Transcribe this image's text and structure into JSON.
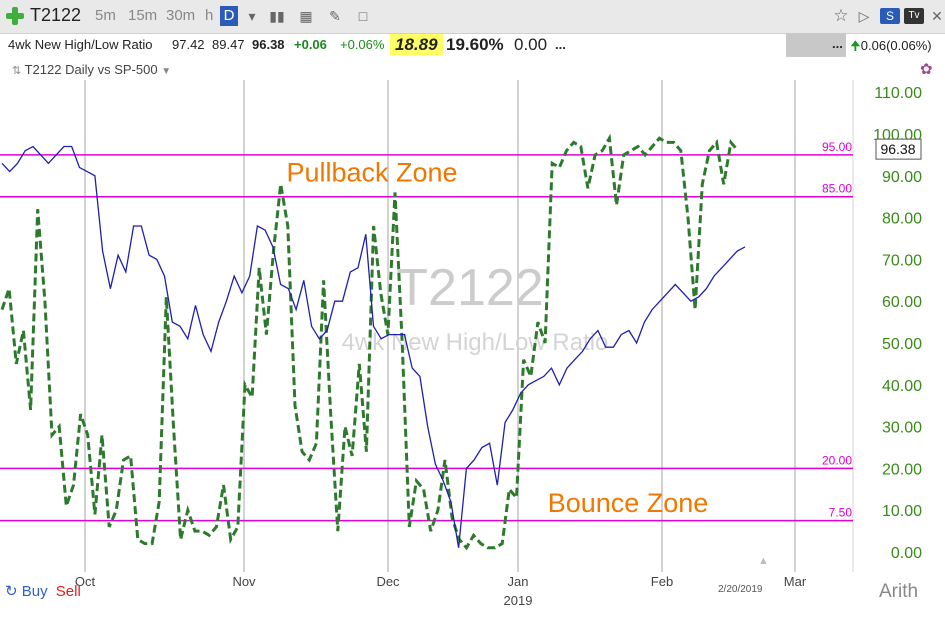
{
  "toolbar": {
    "symbol": "T2122",
    "timeframes": [
      "5m",
      "15m",
      "30m",
      "h"
    ],
    "active_timeframe": "D",
    "right_badge_s": "S",
    "right_badge_tv": "Tv"
  },
  "quote": {
    "name": "4wk New High/Low Ratio",
    "open": "97.42",
    "low": "89.47",
    "last": "96.38",
    "change": "+0.06",
    "change_pct": "+0.06%",
    "highlight_value": "18.89",
    "pct_value": "19.60%",
    "extra_value": "0.00",
    "ellipsis": "...",
    "right_ellipsis": "...",
    "right_change": "0.06(0.06%)"
  },
  "subtitle": "T2122 Daily vs SP-500",
  "footer": {
    "buy": "Buy",
    "sell": "Sell",
    "date_stamp": "2/20/2019",
    "scale_mode": "Arith"
  },
  "colors": {
    "ratio_line": "#2d7a2d",
    "sp500_line": "#1f1fb0",
    "level_line": "#e000d8",
    "annotation": "#f07800",
    "axis_text": "#3a8a1a"
  },
  "chart_data": {
    "type": "line",
    "title": "",
    "watermark": "T2122",
    "watermark_sub": "4wk New High/Low Ratio",
    "ylim": [
      0,
      110
    ],
    "yticks": [
      "0.00",
      "10.00",
      "20.00",
      "30.00",
      "40.00",
      "50.00",
      "60.00",
      "70.00",
      "80.00",
      "90.00",
      "100.00",
      "110.00"
    ],
    "last_value_label": "96.38",
    "x_month_labels": [
      "Oct",
      "Nov",
      "Dec",
      "Jan",
      "Feb",
      "Mar"
    ],
    "x_year_label": "2019",
    "levels": [
      {
        "label": "95.00",
        "value": 95
      },
      {
        "label": "85.00",
        "value": 85
      },
      {
        "label": "20.00",
        "value": 20
      },
      {
        "label": "7.50",
        "value": 7.5
      }
    ],
    "annotations": [
      {
        "text": "Pullback Zone",
        "y": 91
      },
      {
        "text": "Bounce Zone",
        "y": 12
      }
    ],
    "series": [
      {
        "style": "dashed",
        "values": [
          58,
          63,
          45,
          53,
          34,
          82,
          60,
          28,
          30,
          11,
          16,
          33,
          28,
          9,
          28,
          6,
          10,
          22,
          23,
          3,
          2,
          2,
          12,
          61,
          30,
          3,
          10,
          5,
          5,
          4,
          6,
          16,
          3,
          6,
          40,
          37,
          68,
          52,
          72,
          88,
          78,
          35,
          24,
          22,
          26,
          65,
          33,
          5,
          30,
          23,
          45,
          24,
          78,
          62,
          52,
          86,
          50,
          6,
          17,
          15,
          5,
          10,
          22,
          8,
          3,
          1,
          4,
          2,
          1,
          1,
          2,
          15,
          13,
          46,
          42,
          55,
          50,
          93,
          92,
          96,
          98,
          97,
          87,
          95,
          96,
          99,
          83,
          95,
          96,
          97,
          95,
          97,
          99,
          98,
          98,
          96,
          80,
          58,
          88,
          96,
          98,
          88,
          98,
          96
        ]
      },
      {
        "style": "solid",
        "values": [
          93,
          91,
          93,
          96,
          97,
          95,
          93,
          95,
          97,
          97,
          92,
          91,
          90,
          72,
          63,
          71,
          67,
          78,
          78,
          71,
          70,
          66,
          55,
          54,
          51,
          59,
          52,
          48,
          55,
          60,
          66,
          62,
          66,
          78,
          77,
          73,
          64,
          63,
          58,
          65,
          54,
          51,
          53,
          60,
          60,
          67,
          68,
          76,
          54,
          51,
          52,
          52,
          52,
          44,
          42,
          30,
          21,
          17,
          12,
          1,
          20,
          22,
          25,
          26,
          16,
          31,
          34,
          38,
          40,
          41,
          42,
          44,
          40,
          44,
          46,
          48,
          51,
          53,
          49,
          49,
          52,
          53,
          50,
          55,
          58,
          60,
          62,
          64,
          62,
          60,
          61,
          63,
          66,
          68,
          70,
          72,
          73
        ]
      }
    ]
  }
}
